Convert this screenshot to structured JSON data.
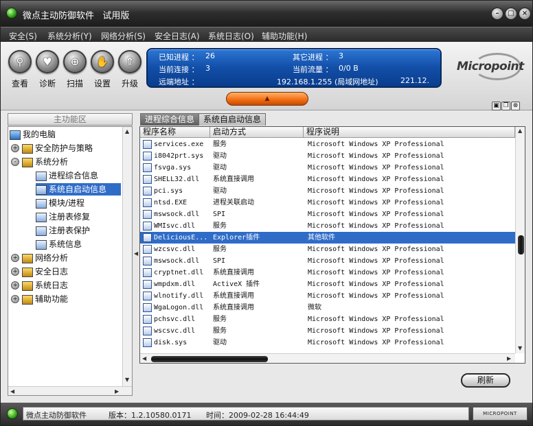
{
  "window": {
    "title": "微点主动防御软件   试用版",
    "controls": [
      "minimize",
      "restore",
      "close"
    ]
  },
  "menu": [
    "安全(S)",
    "系统分析(Y)",
    "网络分析(S)",
    "安全日志(A)",
    "系统日志(O)",
    "辅助功能(H)"
  ],
  "toolbar": {
    "tools": [
      {
        "label": "查看",
        "icon": "magnifier-icon"
      },
      {
        "label": "诊断",
        "icon": "heart-icon"
      },
      {
        "label": "扫描",
        "icon": "scan-icon"
      },
      {
        "label": "设置",
        "icon": "hand-icon"
      },
      {
        "label": "升级",
        "icon": "upgrade-icon"
      }
    ],
    "info": {
      "known_processes_label": "已知进程 ：",
      "known_processes": "26",
      "other_processes_label": "其它进程 ：",
      "other_processes": "3",
      "connections_label": "当前连接 ：",
      "connections": "3",
      "traffic_label": "当前流量 ：",
      "traffic": "0/0 B",
      "remote_label": "远端地址 ：",
      "remote_addr": "192.168.1.255 (局域网地址)",
      "remote_addr2": "221.12."
    },
    "logo": "Micropoint"
  },
  "left_panel": {
    "header": "主功能区",
    "tree": [
      {
        "label": "我的电脑",
        "level": 0,
        "expander": "",
        "icon": "computer"
      },
      {
        "label": "安全防护与策略",
        "level": 1,
        "expander": "+",
        "icon": "folder"
      },
      {
        "label": "系统分析",
        "level": 1,
        "expander": "-",
        "icon": "folder"
      },
      {
        "label": "进程综合信息",
        "level": 2,
        "expander": "",
        "icon": "node"
      },
      {
        "label": "系统自启动信息",
        "level": 2,
        "expander": "",
        "icon": "node",
        "selected": true
      },
      {
        "label": "模块/进程",
        "level": 2,
        "expander": "",
        "icon": "node"
      },
      {
        "label": "注册表修复",
        "level": 2,
        "expander": "",
        "icon": "node"
      },
      {
        "label": "注册表保护",
        "level": 2,
        "expander": "",
        "icon": "node"
      },
      {
        "label": "系统信息",
        "level": 2,
        "expander": "",
        "icon": "node"
      },
      {
        "label": "网络分析",
        "level": 1,
        "expander": "+",
        "icon": "folder"
      },
      {
        "label": "安全日志",
        "level": 1,
        "expander": "+",
        "icon": "folder"
      },
      {
        "label": "系统日志",
        "level": 1,
        "expander": "+",
        "icon": "folder"
      },
      {
        "label": "辅助功能",
        "level": 1,
        "expander": "+",
        "icon": "folder"
      }
    ]
  },
  "tabs": [
    {
      "label": "进程综合信息",
      "active": false
    },
    {
      "label": "系统自启动信息",
      "active": true
    }
  ],
  "table": {
    "columns": [
      "程序名称",
      "启动方式",
      "程序说明"
    ],
    "rows": [
      [
        "services.exe",
        "服务",
        "Microsoft Windows XP Professional"
      ],
      [
        "i8042prt.sys",
        "驱动",
        "Microsoft Windows XP Professional"
      ],
      [
        "fsvga.sys",
        "驱动",
        "Microsoft Windows XP Professional"
      ],
      [
        "SHELL32.dll",
        "系统直接调用",
        "Microsoft Windows XP Professional"
      ],
      [
        "pci.sys",
        "驱动",
        "Microsoft Windows XP Professional"
      ],
      [
        "ntsd.EXE",
        "进程关联启动",
        "Microsoft Windows XP Professional"
      ],
      [
        "mswsock.dll",
        "SPI",
        "Microsoft Windows XP Professional"
      ],
      [
        "WMIsvc.dll",
        "服务",
        "Microsoft Windows XP Professional"
      ],
      [
        "DeliciousE...",
        "Explorer插件",
        "其他软件"
      ],
      [
        "wzcsvc.dll",
        "服务",
        "Microsoft Windows XP Professional"
      ],
      [
        "mswsock.dll",
        "SPI",
        "Microsoft Windows XP Professional"
      ],
      [
        "cryptnet.dll",
        "系统直接调用",
        "Microsoft Windows XP Professional"
      ],
      [
        "wmpdxm.dll",
        "ActiveX 插件",
        "Microsoft Windows XP Professional"
      ],
      [
        "wlnotify.dll",
        "系统直接调用",
        "Microsoft Windows XP Professional"
      ],
      [
        "WgaLogon.dll",
        "系统直接调用",
        "微软"
      ],
      [
        "pchsvc.dll",
        "服务",
        "Microsoft Windows XP Professional"
      ],
      [
        "wscsvc.dll",
        "服务",
        "Microsoft Windows XP Professional"
      ],
      [
        "disk.sys",
        "驱动",
        "Microsoft Windows XP Professional"
      ]
    ],
    "selected_row": 8
  },
  "refresh_label": "刷新",
  "status": {
    "app_name": "微点主动防御软件",
    "version": "版本：1.2.10580.0171",
    "time": "时间：2009-02-28 16:44:49",
    "logo": "MICROPOINT"
  }
}
